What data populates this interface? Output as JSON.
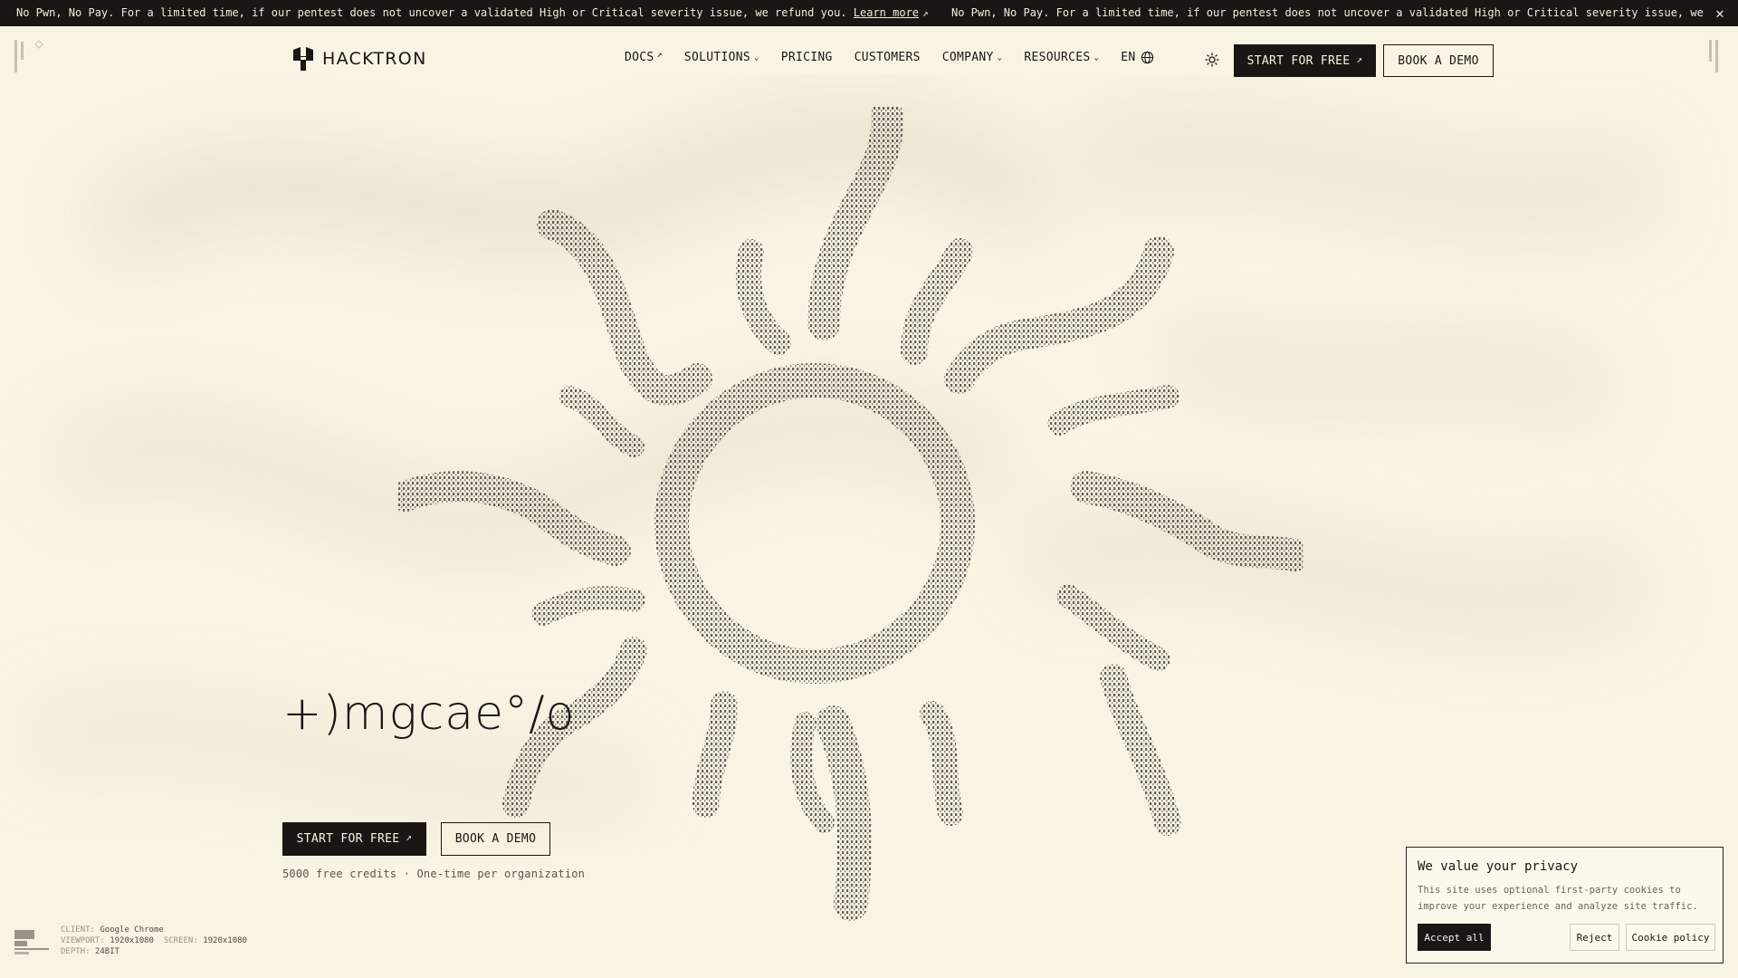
{
  "announcement": {
    "message": "No Pwn, No Pay. For a limited time, if our pentest does not uncover a validated High or Critical severity issue, we refund you.",
    "link_label": "Learn more",
    "repeat_message": "No Pwn, No Pay. For a limited time, if our pentest does not uncover a validated High or Critical severity issue, we refund you.",
    "close_glyph": "✕"
  },
  "nav": {
    "logo_text": "HACKTRON",
    "links": [
      {
        "label": "DOCS",
        "suffix": "↗"
      },
      {
        "label": "SOLUTIONS",
        "suffix": "⌄"
      },
      {
        "label": "PRICING",
        "suffix": ""
      },
      {
        "label": "CUSTOMERS",
        "suffix": ""
      },
      {
        "label": "COMPANY",
        "suffix": "⌄"
      },
      {
        "label": "RESOURCES",
        "suffix": "⌄"
      }
    ],
    "language": "EN",
    "start_label": "START FOR FREE",
    "demo_label": "BOOK A DEMO"
  },
  "hero": {
    "title": "+)mgcae°/o",
    "start_label": "START FOR FREE",
    "demo_label": "BOOK A DEMO",
    "subtext": "5000 free credits · One-time per organization"
  },
  "client_info": {
    "client_label": "CLIENT:",
    "client_value": "Google Chrome",
    "viewport_label": "VIEWPORT:",
    "viewport_value": "1920x1080",
    "screen_label": "SCREEN:",
    "screen_value": "1920x1080",
    "depth_label": "DEPTH:",
    "depth_value": "24BIT"
  },
  "cookie": {
    "title": "We value your privacy",
    "text": "This site uses optional first-party cookies to improve your experience and analyze site traffic.",
    "accept_label": "Accept all",
    "reject_label": "Reject",
    "policy_label": "Cookie policy"
  },
  "colors": {
    "background": "#f9f3e3",
    "ink": "#1b1515",
    "muted": "#6a635d"
  }
}
